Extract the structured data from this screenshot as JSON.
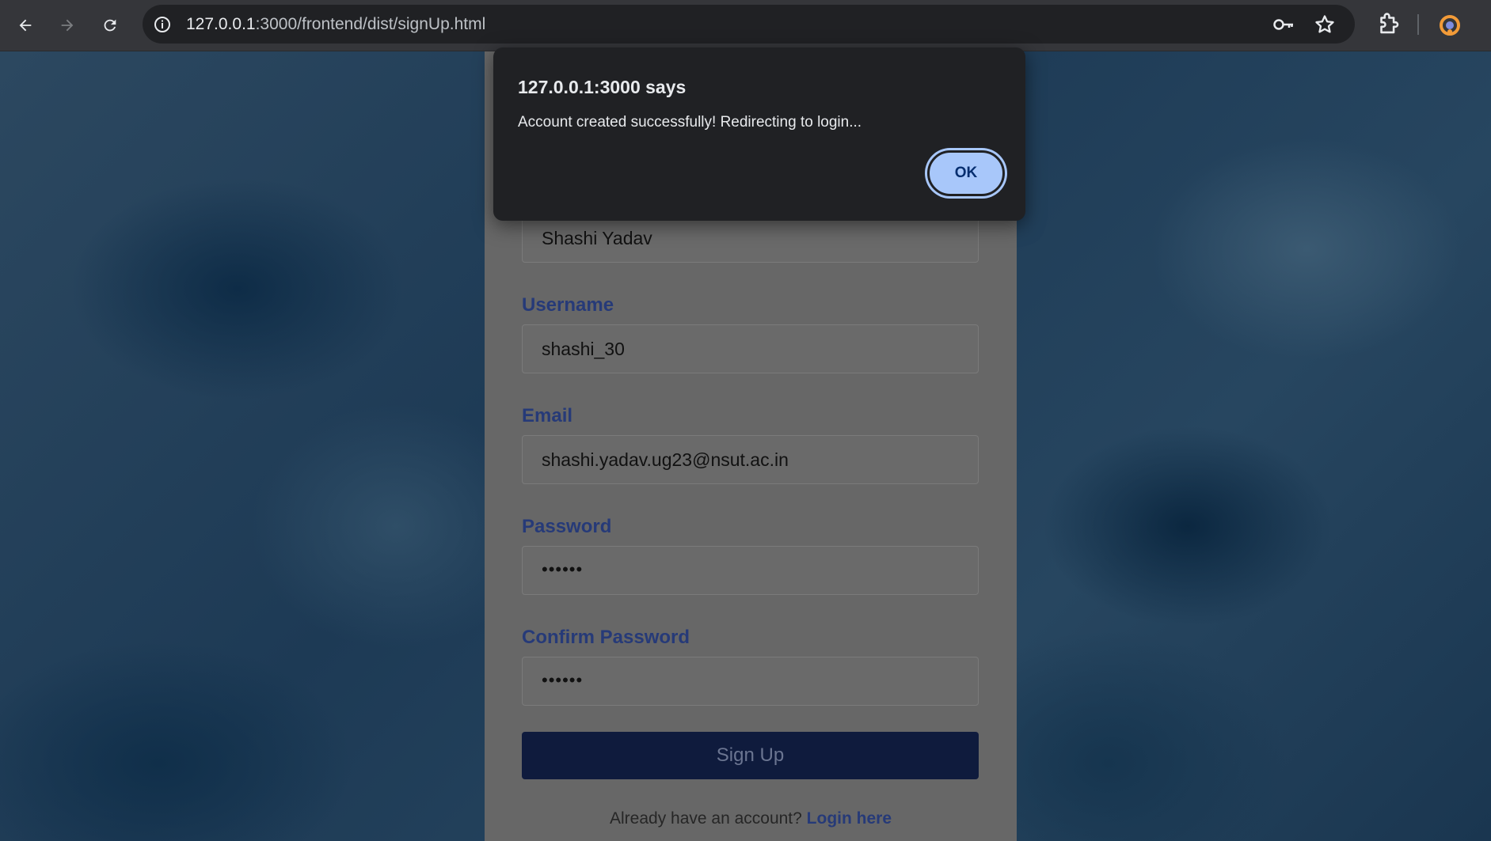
{
  "browser": {
    "url_host": "127.0.0.1",
    "url_rest": ":3000/frontend/dist/signUp.html"
  },
  "form": {
    "fullname_value": "Shashi Yadav",
    "username_label": "Username",
    "username_value": "shashi_30",
    "email_label": "Email",
    "email_value": "shashi.yadav.ug23@nsut.ac.in",
    "password_label": "Password",
    "password_value": "••••••",
    "confirm_label": "Confirm Password",
    "confirm_value": "••••••",
    "submit_label": "Sign Up",
    "footer_text": "Already have an account?",
    "footer_link": "Login here"
  },
  "dialog": {
    "title": "127.0.0.1:3000 says",
    "message": "Account created successfully! Redirecting to login...",
    "ok_label": "OK"
  },
  "colors": {
    "accent": "#a8c7fa",
    "label_blue": "#263a78",
    "button_navy": "#0f1b3d"
  }
}
